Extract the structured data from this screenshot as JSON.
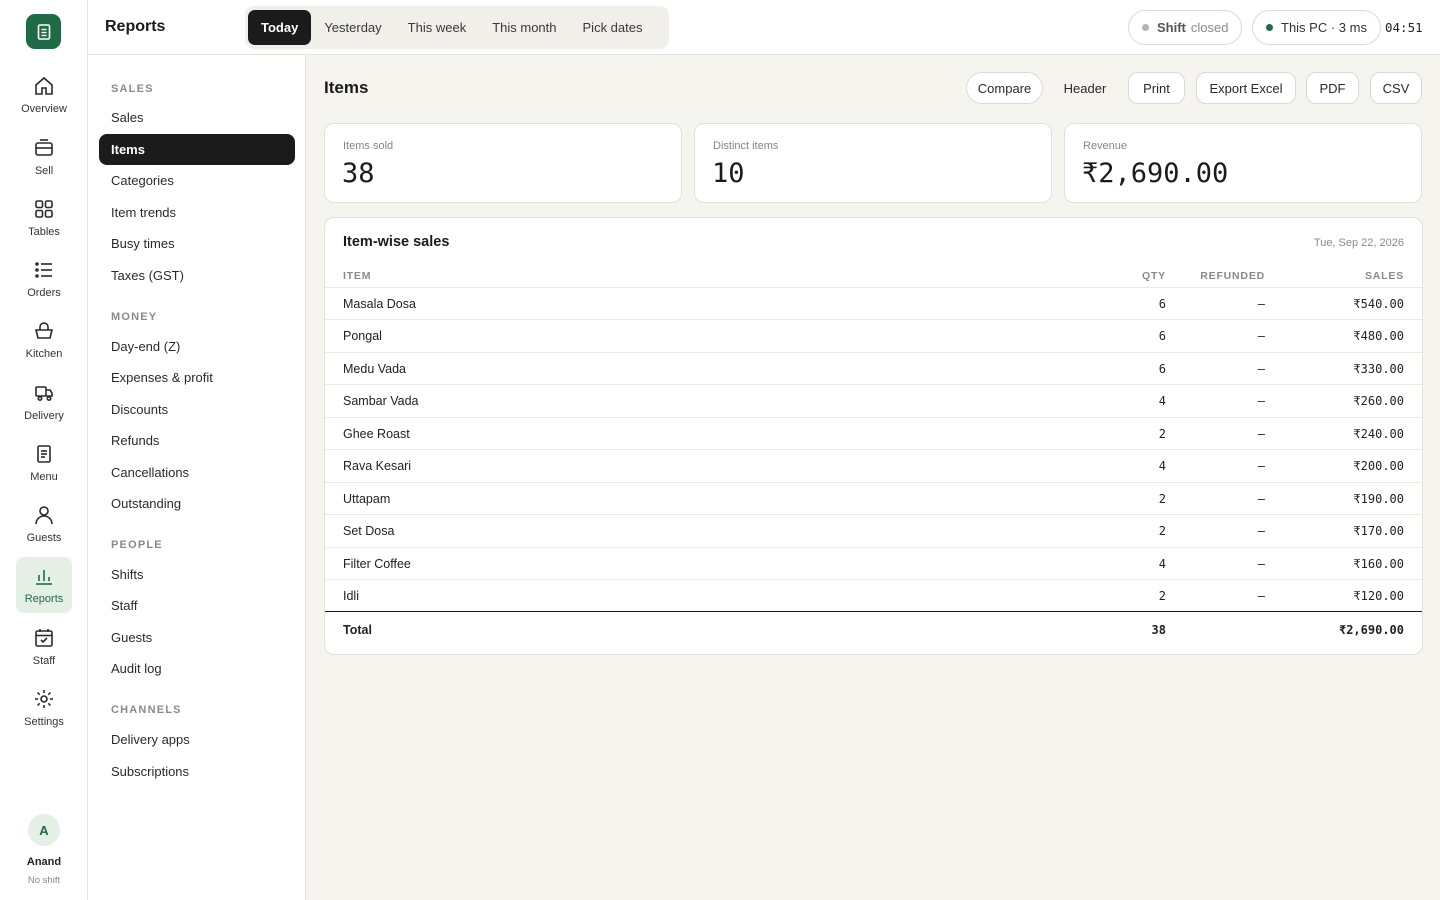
{
  "app": {
    "section_title": "Reports"
  },
  "rail": {
    "items": [
      {
        "label": "Overview",
        "icon": "home-icon"
      },
      {
        "label": "Sell",
        "icon": "register-icon"
      },
      {
        "label": "Tables",
        "icon": "grid-icon"
      },
      {
        "label": "Orders",
        "icon": "list-icon"
      },
      {
        "label": "Kitchen",
        "icon": "basket-icon"
      },
      {
        "label": "Delivery",
        "icon": "delivery-icon"
      },
      {
        "label": "Menu",
        "icon": "menu-doc-icon"
      },
      {
        "label": "Guests",
        "icon": "person-icon"
      },
      {
        "label": "Reports",
        "icon": "bar-chart-icon",
        "active": true
      },
      {
        "label": "Staff",
        "icon": "calendar-icon"
      },
      {
        "label": "Settings",
        "icon": "gear-icon"
      }
    ],
    "user": {
      "initial": "A",
      "name": "Anand",
      "shift": "No shift"
    }
  },
  "header": {
    "ranges": [
      "Today",
      "Yesterday",
      "This week",
      "This month",
      "Pick dates"
    ],
    "active_range": "Today",
    "shift_label": "Shift",
    "shift_status": "closed",
    "device": "This PC · 3 ms",
    "clock": "04:51"
  },
  "subnav": {
    "sections": [
      {
        "title": "SALES",
        "items": [
          "Sales",
          "Items",
          "Categories",
          "Item trends",
          "Busy times",
          "Taxes (GST)"
        ]
      },
      {
        "title": "MONEY",
        "items": [
          "Day-end (Z)",
          "Expenses & profit",
          "Discounts",
          "Refunds",
          "Cancellations",
          "Outstanding"
        ]
      },
      {
        "title": "PEOPLE",
        "items": [
          "Shifts",
          "Staff",
          "Guests",
          "Audit log"
        ]
      },
      {
        "title": "CHANNELS",
        "items": [
          "Delivery apps",
          "Subscriptions"
        ]
      }
    ],
    "active": "Items"
  },
  "main": {
    "title": "Items",
    "actions": [
      "Compare",
      "Header",
      "Print",
      "Export Excel",
      "PDF",
      "CSV"
    ],
    "stats": [
      {
        "label": "Items sold",
        "value": "38"
      },
      {
        "label": "Distinct items",
        "value": "10"
      },
      {
        "label": "Revenue",
        "value": "₹2,690.00"
      }
    ],
    "table": {
      "title": "Item-wise sales",
      "date": "Tue, Sep 22, 2026",
      "columns": [
        "ITEM",
        "QTY",
        "REFUNDED",
        "SALES"
      ],
      "rows": [
        {
          "item": "Masala Dosa",
          "qty": "6",
          "refunded": "–",
          "sales": "₹540.00"
        },
        {
          "item": "Pongal",
          "qty": "6",
          "refunded": "–",
          "sales": "₹480.00"
        },
        {
          "item": "Medu Vada",
          "qty": "6",
          "refunded": "–",
          "sales": "₹330.00"
        },
        {
          "item": "Sambar Vada",
          "qty": "4",
          "refunded": "–",
          "sales": "₹260.00"
        },
        {
          "item": "Ghee Roast",
          "qty": "2",
          "refunded": "–",
          "sales": "₹240.00"
        },
        {
          "item": "Rava Kesari",
          "qty": "4",
          "refunded": "–",
          "sales": "₹200.00"
        },
        {
          "item": "Uttapam",
          "qty": "2",
          "refunded": "–",
          "sales": "₹190.00"
        },
        {
          "item": "Set Dosa",
          "qty": "2",
          "refunded": "–",
          "sales": "₹170.00"
        },
        {
          "item": "Filter Coffee",
          "qty": "4",
          "refunded": "–",
          "sales": "₹160.00"
        },
        {
          "item": "Idli",
          "qty": "2",
          "refunded": "–",
          "sales": "₹120.00"
        }
      ],
      "total": {
        "label": "Total",
        "qty": "38",
        "sales": "₹2,690.00"
      }
    }
  },
  "colors": {
    "brand": "#1f6b45",
    "active_bg": "#1b1b1b",
    "shift_dot": "#b5b5ae",
    "device_dot": "#1f6b45"
  }
}
